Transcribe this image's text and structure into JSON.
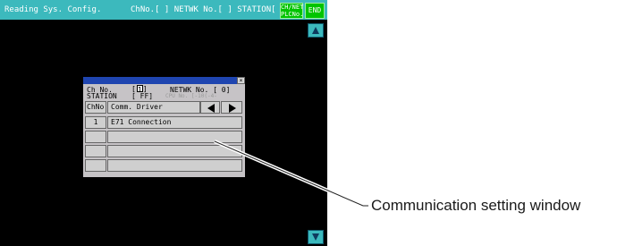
{
  "topbar": {
    "title": "Reading Sys. Config.",
    "channel_info": "ChNo.[ ] NETWK No.[  ] STATION[  ]",
    "chnet_line1": "CH/NET",
    "chnet_line2": "PLCNo.",
    "end_label": "END"
  },
  "dialog": {
    "ch_no_label": "Ch No.",
    "ch_no_value": "1",
    "station_label": "STATION",
    "station_value": "[ FF]",
    "netwk_label": "NETWK No. [  0]",
    "cpu_label": "CPU No.   [-10(-4-",
    "close_glyph": "×",
    "table": {
      "headers": {
        "chno": "ChNo",
        "driver": "Comm. Driver"
      },
      "rows": [
        {
          "chno": "1",
          "driver": "E71 Connection"
        },
        {
          "chno": "",
          "driver": ""
        },
        {
          "chno": "",
          "driver": ""
        },
        {
          "chno": "",
          "driver": ""
        }
      ]
    }
  },
  "icons": {
    "scroll_up": "triangle-up-icon",
    "scroll_down": "triangle-down-icon",
    "prev": "triangle-left-icon",
    "next": "triangle-right-icon"
  },
  "callout": {
    "text": "Communication setting window"
  },
  "colors": {
    "titlebar": "#3cb9bd",
    "end_button": "#00c400",
    "dialog_titlebar": "#1f45b0",
    "dialog_bg": "#c6c3c6",
    "screen_bg": "#000000"
  }
}
